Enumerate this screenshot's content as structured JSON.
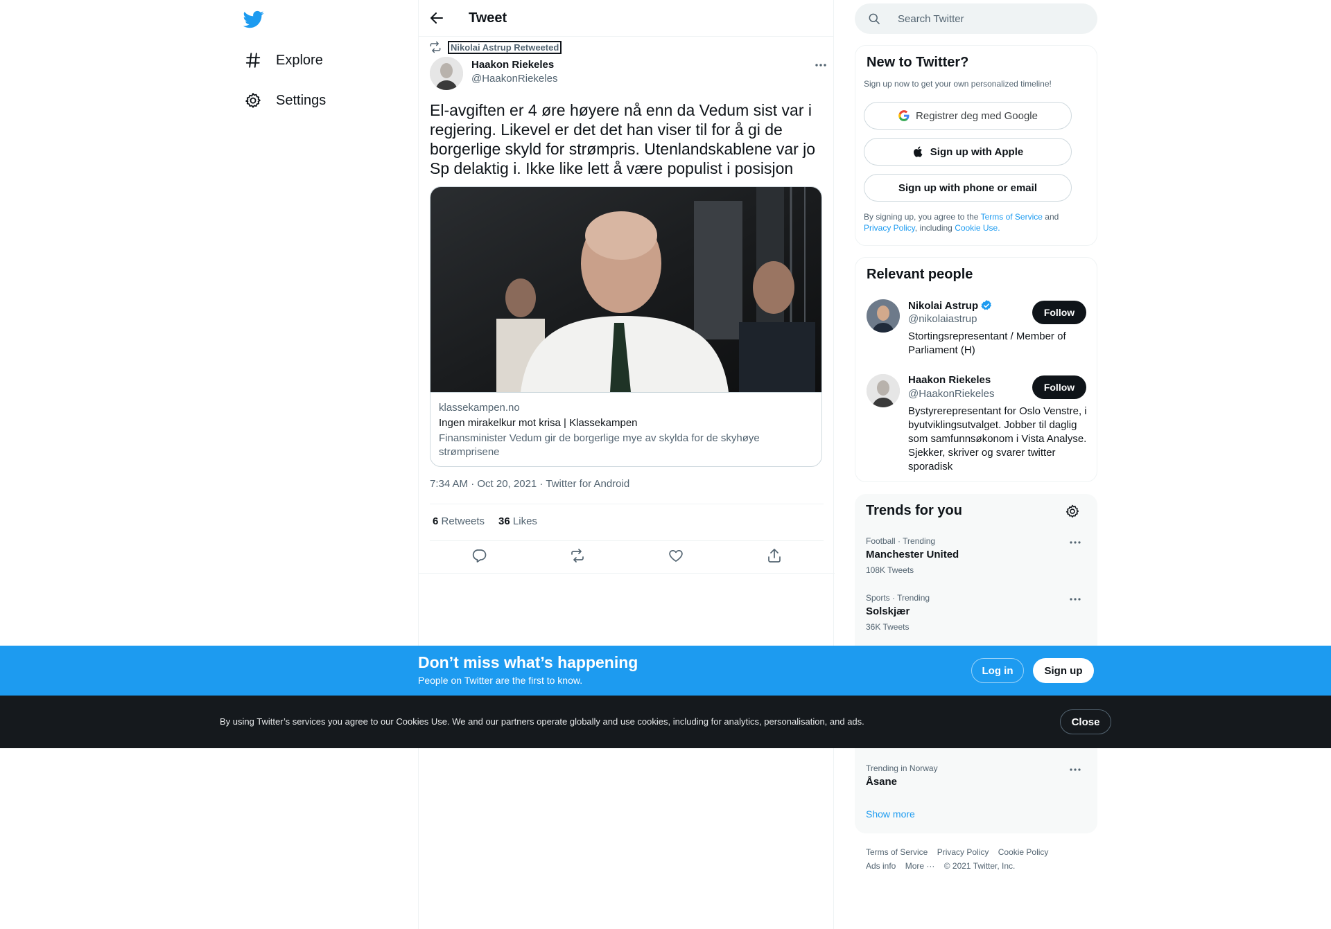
{
  "nav": {
    "explore_label": "Explore",
    "settings_label": "Settings"
  },
  "header": {
    "title": "Tweet"
  },
  "tweet": {
    "retweeted_by": "Nikolai Astrup Retweeted",
    "author_name": "Haakon Riekeles",
    "author_handle": "@HaakonRiekeles",
    "text": "El-avgiften er 4 øre høyere nå enn da Vedum sist var i regjering. Likevel er det det han viser til for å gi de borgerlige skyld for strømpris. Utenlandskablene var jo Sp delaktig i. Ikke like lett å være populist i posisjon",
    "card": {
      "domain": "klassekampen.no",
      "title": "Ingen mirakelkur mot krisa | Klassekampen",
      "description": "Finansminister Vedum gir de borgerlige mye av skylda for de skyhøye strømprisene"
    },
    "timestamp": "7:34 AM · Oct 20, 2021 · Twitter for Android",
    "retweets_count": "6",
    "retweets_label": "Retweets",
    "likes_count": "36",
    "likes_label": "Likes"
  },
  "search": {
    "placeholder": "Search Twitter"
  },
  "new_to_twitter": {
    "title": "New to Twitter?",
    "subtitle": "Sign up now to get your own personalized timeline!",
    "google_label": "Registrer deg med Google",
    "apple_label": "Sign up with Apple",
    "phone_label": "Sign up with phone or email",
    "legal_prefix": "By signing up, you agree to the",
    "terms_link": "Terms of Service",
    "legal_and": "and",
    "privacy_link": "Privacy Policy",
    "legal_including": ", including",
    "cookie_link": "Cookie Use."
  },
  "relevant_people": {
    "title": "Relevant people",
    "people": [
      {
        "name": "Nikolai Astrup",
        "handle": "@nikolaiastrup",
        "bio": "Stortingsrepresentant / Member of Parliament (H)",
        "follow_label": "Follow",
        "verified": true
      },
      {
        "name": "Haakon Riekeles",
        "handle": "@HaakonRiekeles",
        "bio": "Bystyrerepresentant for Oslo Venstre, i byutviklingsutvalget. Jobber til daglig som samfunnsøkonom i Vista Analyse. Sjekker, skriver og svarer twitter sporadisk",
        "follow_label": "Follow",
        "verified": false
      }
    ]
  },
  "trends": {
    "title": "Trends for you",
    "items": [
      {
        "context": "Football · Trending",
        "name": "Manchester United",
        "count": "108K Tweets"
      },
      {
        "context": "Sports · Trending",
        "name": "Solskjær",
        "count": "36K Tweets"
      },
      {
        "context": "Trending in Norway",
        "name": "Åsane",
        "count": ""
      }
    ],
    "show_more": "Show more"
  },
  "footer": {
    "links": [
      "Terms of Service",
      "Privacy Policy",
      "Cookie Policy",
      "Ads info",
      "More ···",
      "© 2021 Twitter, Inc."
    ]
  },
  "signup_bar": {
    "headline": "Don’t miss what’s happening",
    "subline": "People on Twitter are the first to know.",
    "login_label": "Log in",
    "signup_label": "Sign up"
  },
  "cookie_bar": {
    "text": "By using Twitter’s services you agree to our Cookies Use. We and our partners operate globally and use cookies, including for analytics, personalisation, and ads.",
    "close_label": "Close"
  },
  "colors": {
    "accent": "#1d9bf0",
    "text_primary": "#0f1419",
    "text_secondary": "#536471",
    "cookie_bar_bg": "#15191d"
  },
  "icons": {
    "logo": "twitter-bird-icon",
    "explore": "hashtag-icon",
    "settings": "gear-icon",
    "back": "arrow-left-icon",
    "retweet": "retweet-icon",
    "more": "more-dots-icon",
    "reply": "reply-icon",
    "like": "heart-icon",
    "share": "share-icon",
    "search": "search-icon",
    "verified": "verified-badge-icon"
  }
}
